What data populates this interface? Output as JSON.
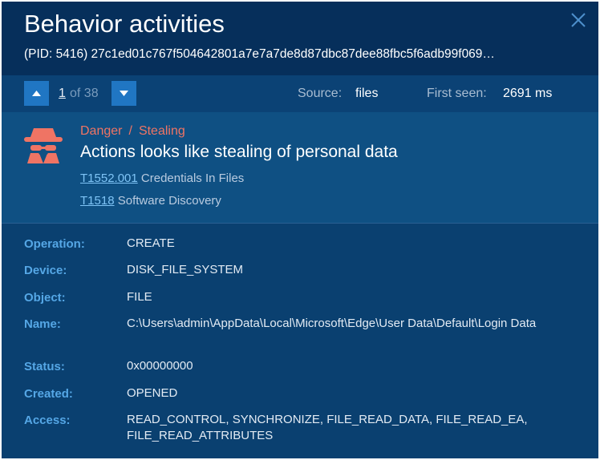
{
  "header": {
    "title": "Behavior activities",
    "subtitle": "(PID: 5416) 27c1ed01c767f504642801a7e7a7de8d87dbc87dee88fbc5f6adb99f069…"
  },
  "nav": {
    "current": "1",
    "of_text": "of 38",
    "source_label": "Source:",
    "source_value": "files",
    "first_seen_label": "First seen:",
    "first_seen_value": "2691 ms"
  },
  "threat": {
    "icon": "spy-icon",
    "severity": "Danger",
    "separator": "/",
    "category": "Stealing",
    "title": "Actions looks like stealing of personal data",
    "techniques": [
      {
        "id": "T1552.001",
        "name": "Credentials In Files"
      },
      {
        "id": "T1518",
        "name": "Software Discovery"
      }
    ]
  },
  "details": [
    {
      "label": "Operation:",
      "value": "CREATE"
    },
    {
      "label": "Device:",
      "value": "DISK_FILE_SYSTEM"
    },
    {
      "label": "Object:",
      "value": "FILE"
    },
    {
      "label": "Name:",
      "value": "C:\\Users\\admin\\AppData\\Local\\Microsoft\\Edge\\User Data\\Default\\Login Data"
    },
    {
      "label": "Status:",
      "value": "0x00000000"
    },
    {
      "label": "Created:",
      "value": "OPENED"
    },
    {
      "label": "Access:",
      "value": "READ_CONTROL, SYNCHRONIZE, FILE_READ_DATA, FILE_READ_EA, FILE_READ_ATTRIBUTES"
    }
  ],
  "colors": {
    "panel_bg": "#07386a",
    "accent": "#2076c3",
    "danger": "#ef7464",
    "label": "#55a7e6",
    "link": "#7fc4f6"
  }
}
